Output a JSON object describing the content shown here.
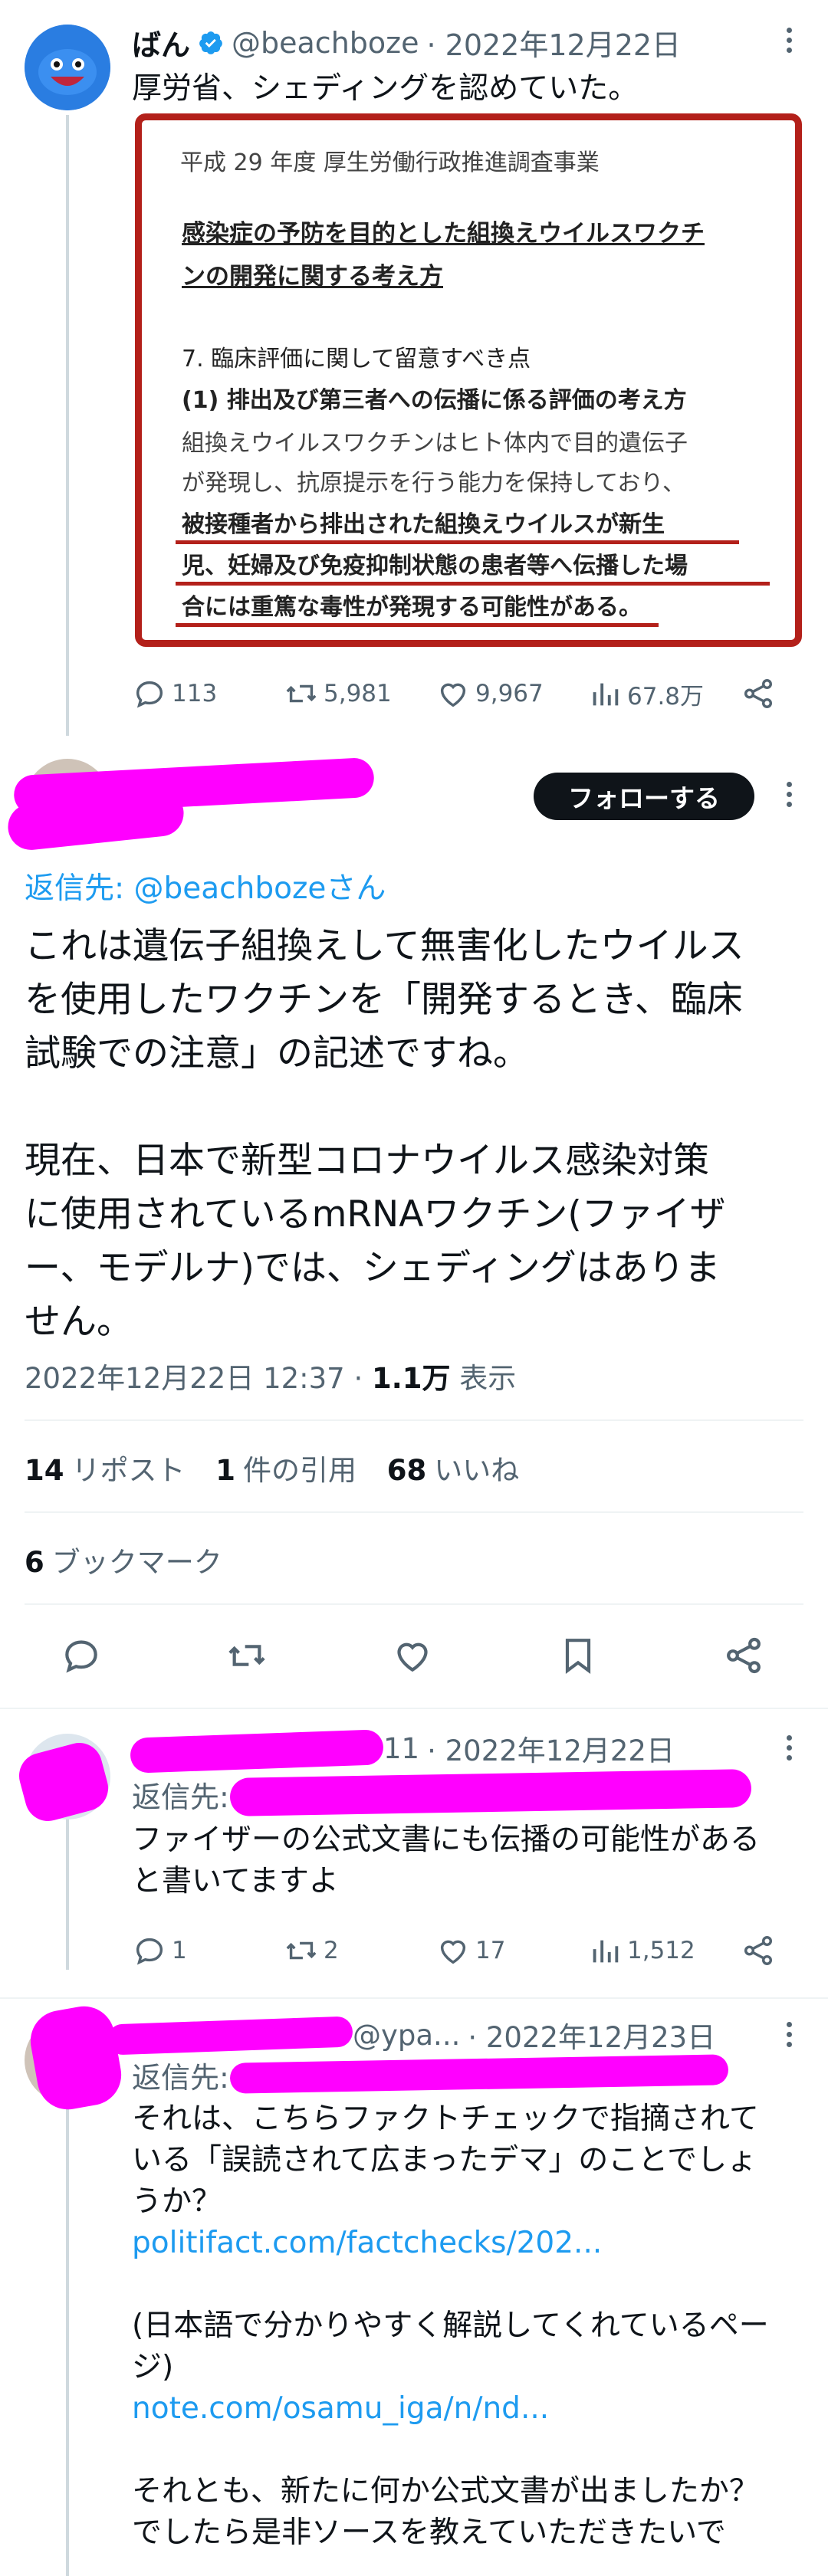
{
  "tweet1": {
    "name": "ばん",
    "handle": "@beachboze",
    "date": "· 2022年12月22日",
    "text": "厚労省、シェディングを認めていた。",
    "doc": {
      "header": "平成 29 年度 厚生労働行政推進調査事業",
      "title_line1": "感染症の予防を目的とした組換えウイルスワクチ",
      "title_line2": "ンの開発に関する考え方",
      "section": "7. 臨床評価に関して留意すべき点",
      "subsection": "(1) 排出及び第三者への伝播に係る評価の考え方",
      "body_line1": "組換えウイルスワクチンはヒト体内で目的遺伝子",
      "body_line2": "が発現し、抗原提示を行う能力を保持しており、",
      "body_line3": "被接種者から排出された組換えウイルスが新生",
      "body_line4": "児、妊婦及び免疫抑制状態の患者等へ伝播した場",
      "body_line5": "合には重篤な毒性が発現する可能性がある。"
    },
    "replies": "113",
    "retweets": "5,981",
    "likes": "9,967",
    "views": "67.8万"
  },
  "tweet2": {
    "follow_label": "フォローする",
    "reply_to": "返信先: @beachbozeさん",
    "text_line1": "これは遺伝子組換えして無害化したウイルス",
    "text_line2": "を使用したワクチンを「開発するとき、臨床",
    "text_line3": "試験での注意」の記述ですね。",
    "text_line4": "現在、日本で新型コロナウイルス感染対策",
    "text_line5": "に使用されているmRNAワクチン(ファイザ",
    "text_line6": "ー、モデルナ)では、シェディングはありま",
    "text_line7": "せん。",
    "timestamp": "2022年12月22日 12:37 · ",
    "views_count": "1.1万",
    "views_label": " 表示",
    "reposts_count": "14",
    "reposts_label": "リポスト",
    "quotes_count": "1",
    "quotes_label": "件の引用",
    "likes_count": "68",
    "likes_label": "いいね",
    "bookmarks_count": "6",
    "bookmarks_label": "ブックマーク"
  },
  "reply1": {
    "handle_tail": "11",
    "date": "· 2022年12月22日",
    "reply_to": "返信先:",
    "text_line1": "ファイザーの公式文書にも伝播の可能性がある",
    "text_line2": "と書いてますよ",
    "replies": "1",
    "retweets": "2",
    "likes": "17",
    "views": "1,512"
  },
  "reply2": {
    "handle": "@ypa...",
    "date": "· 2022年12月23日",
    "reply_to": "返信先:",
    "text_line1": "それは、こちらファクトチェックで指摘されて",
    "text_line2": "いる「誤読されて広まったデマ」のことでしょ",
    "text_line3": "うか？",
    "link1": "politifact.com/factchecks/202...",
    "text_line4": "(日本語で分かりやすく解説してくれているペー",
    "text_line5": "ジ)",
    "link2": "note.com/osamu_iga/n/nd...",
    "text_line6": "それとも、新たに何か公式文書が出ましたか？",
    "text_line7": "でしたら是非ソースを教えていただきたいで"
  },
  "colors": {
    "accent": "#1d9bf0",
    "redact": "#ff00ff",
    "doc_border": "#b3201a"
  }
}
